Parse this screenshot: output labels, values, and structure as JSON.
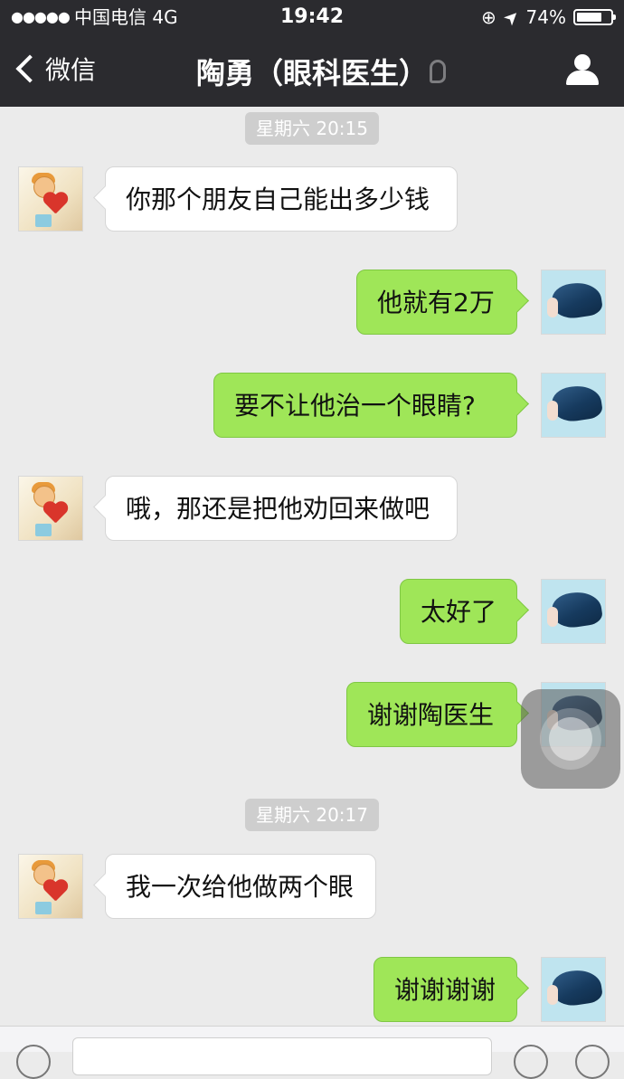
{
  "status_bar": {
    "signal": "●●●●●",
    "carrier": "中国电信  4G",
    "time": "19:42",
    "lock_glyph": "⊕",
    "location_glyph": "➤",
    "battery": "74%",
    "battery_level": 0.74
  },
  "nav": {
    "back_label": "微信",
    "title": "陶勇（眼科医生）"
  },
  "chat": {
    "timestamps": [
      "星期六 20:15",
      "星期六 20:17"
    ],
    "messages": [
      {
        "from": "other",
        "text": "你那个朋友自己能出多少钱"
      },
      {
        "from": "self",
        "text": "他就有2万"
      },
      {
        "from": "self",
        "text": "要不让他治一个眼睛?"
      },
      {
        "from": "other",
        "text": "哦，那还是把他劝回来做吧"
      },
      {
        "from": "self",
        "text": "太好了"
      },
      {
        "from": "self",
        "text": "谢谢陶医生"
      },
      {
        "from": "other",
        "text": "我一次给他做两个眼"
      },
      {
        "from": "self",
        "text": "谢谢谢谢"
      }
    ]
  }
}
